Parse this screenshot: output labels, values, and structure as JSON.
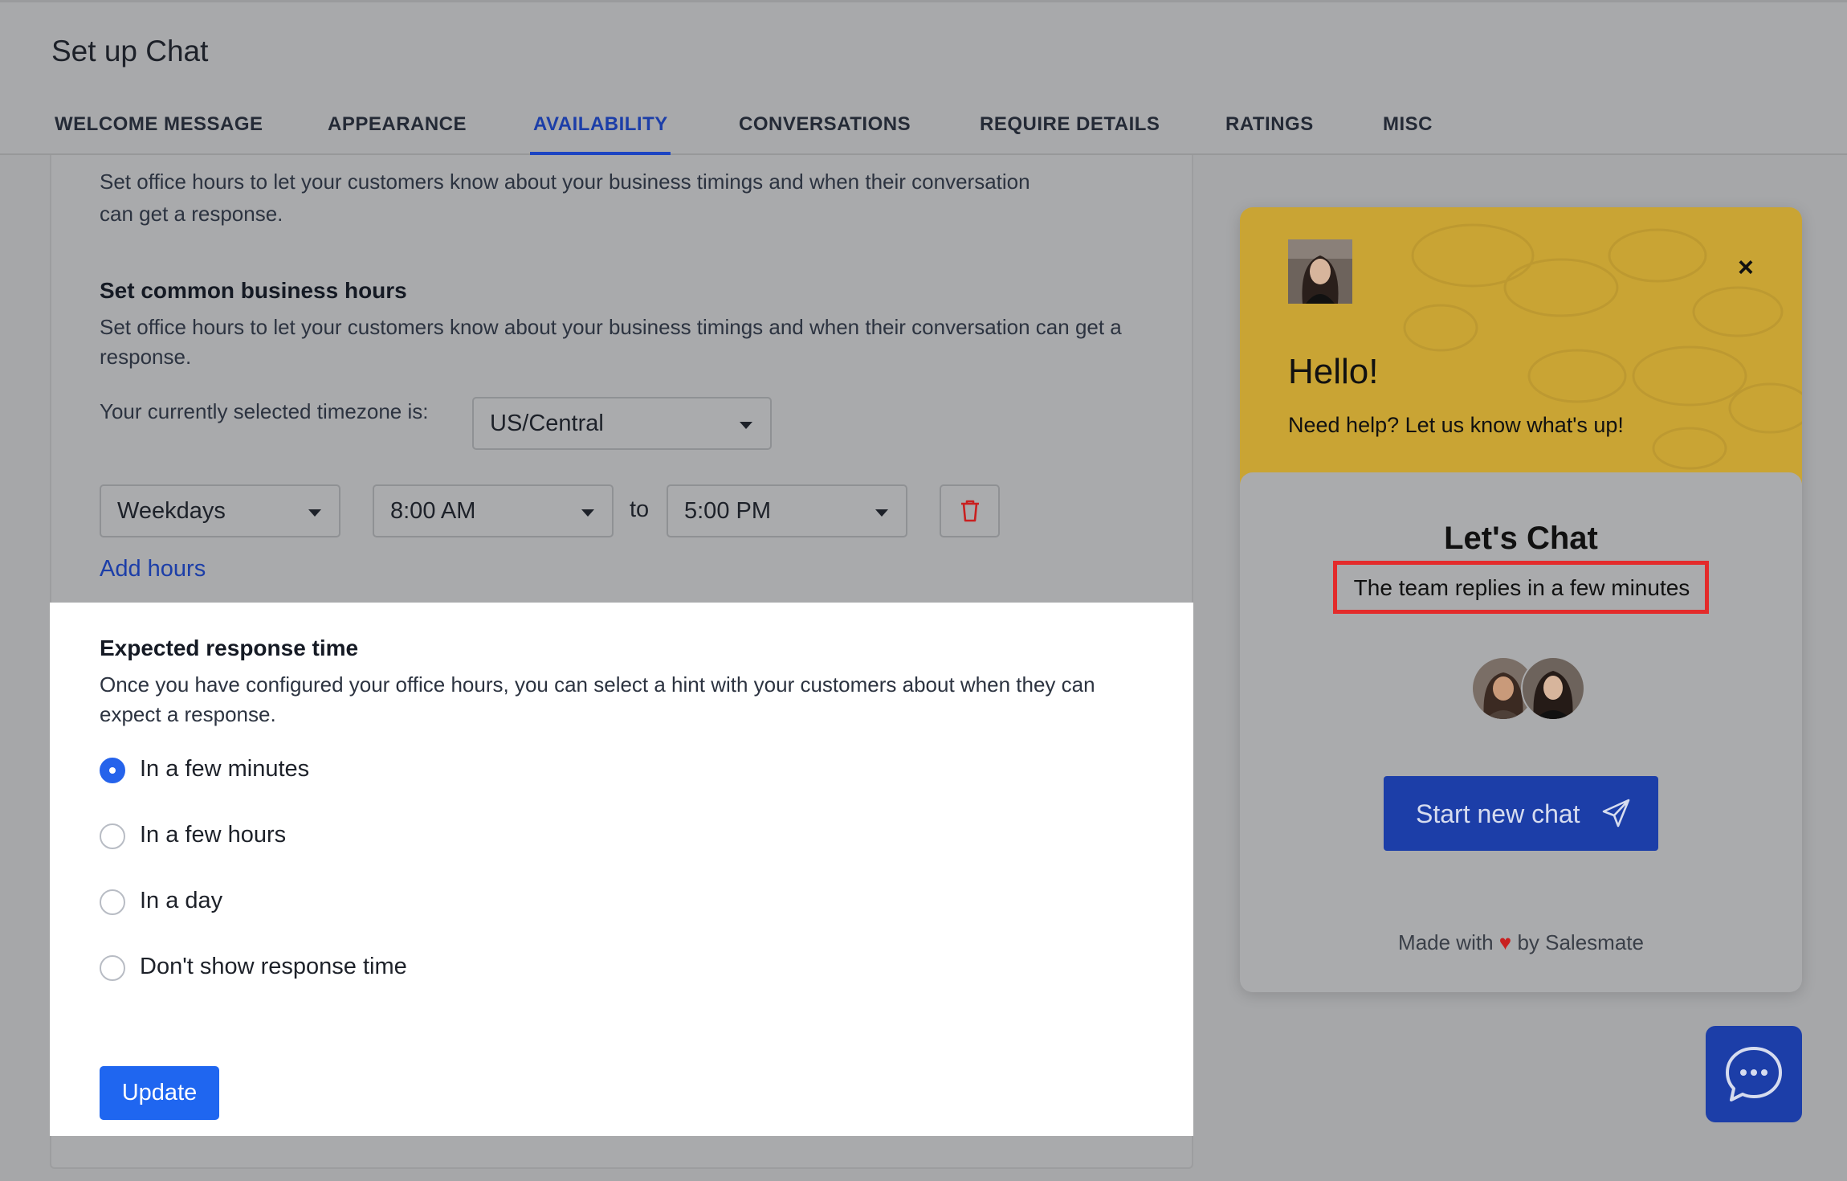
{
  "header": {
    "title": "Set up Chat",
    "tabs": [
      {
        "label": "WELCOME MESSAGE"
      },
      {
        "label": "APPEARANCE"
      },
      {
        "label": "AVAILABILITY",
        "active": true
      },
      {
        "label": "CONVERSATIONS"
      },
      {
        "label": "REQUIRE DETAILS"
      },
      {
        "label": "RATINGS"
      },
      {
        "label": "MISC"
      }
    ]
  },
  "office_hours": {
    "intro": "Set office hours to let your customers know about your business timings and when their conversation can get a response.",
    "heading": "Set common business hours",
    "description": "Set office hours to let your customers know about your business timings and when their conversation can get a response.",
    "timezone_label": "Your currently selected timezone is:",
    "timezone": "US/Central",
    "row": {
      "days": "Weekdays",
      "from": "8:00 AM",
      "to_label": "to",
      "to": "5:00 PM"
    },
    "add_hours": "Add hours"
  },
  "response_time": {
    "heading": "Expected response time",
    "description": "Once you have configured your office hours, you can select a hint with your customers about when they can expect a response.",
    "options": [
      {
        "label": "In a few minutes",
        "checked": true
      },
      {
        "label": "In a few hours",
        "checked": false
      },
      {
        "label": "In a day",
        "checked": false
      },
      {
        "label": "Don't show response time",
        "checked": false
      }
    ],
    "update": "Update"
  },
  "widget": {
    "close": "×",
    "hello": "Hello!",
    "help": "Need help? Let us know what's up!",
    "lets_chat": "Let's Chat",
    "replies": "The team replies in a few minutes",
    "start_chat": "Start new chat",
    "made_with_prefix": "Made with",
    "made_with_suffix": "by Salesmate",
    "heart": "♥"
  },
  "colors": {
    "accent": "#1f66f0",
    "widget_header": "#c9a434",
    "highlight": "#e32b2b",
    "delete_icon": "#c92020"
  },
  "icons": [
    "caret-down-icon",
    "trash-icon",
    "close-icon",
    "send-icon",
    "heart-icon",
    "chat-bubble-icon"
  ]
}
